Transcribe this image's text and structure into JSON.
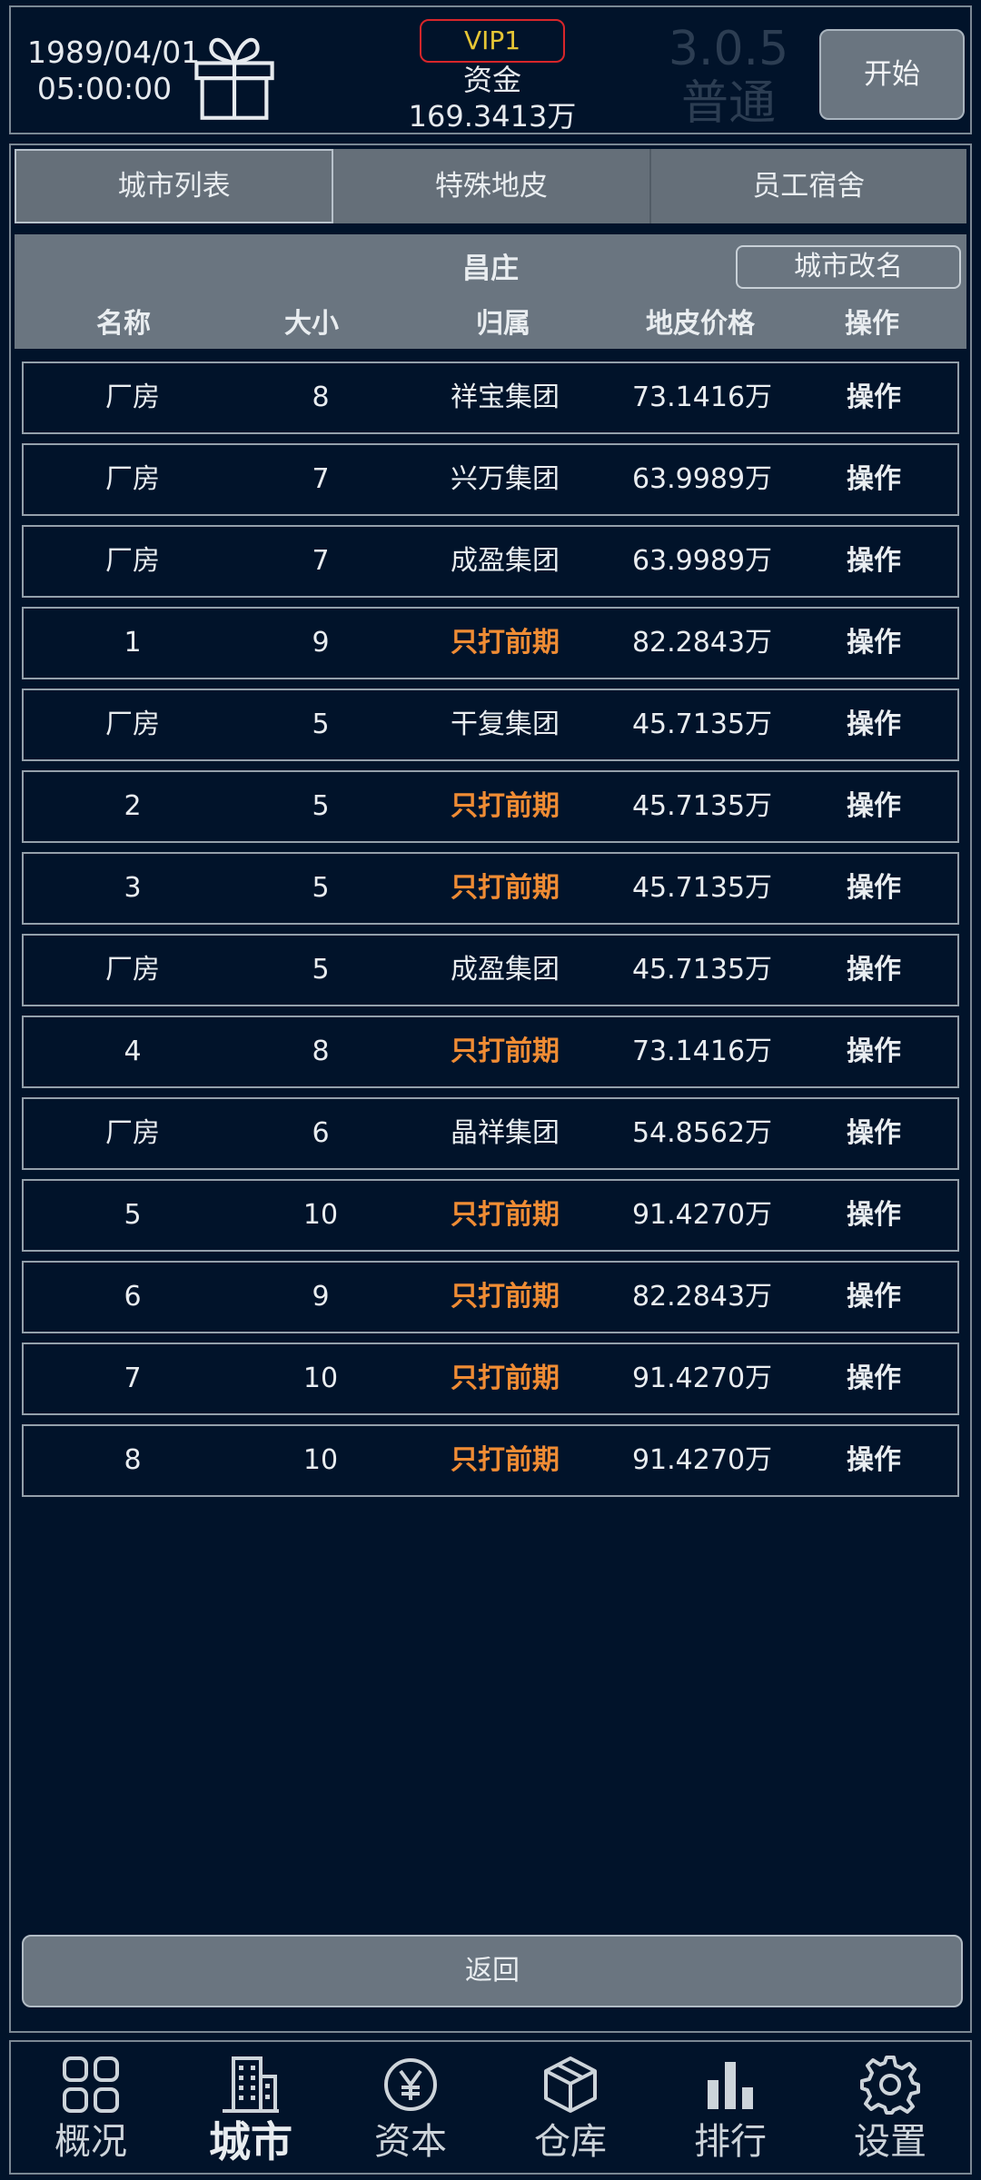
{
  "header": {
    "date": "1989/04/01",
    "time": "05:00:00",
    "vip": "VIP1",
    "funds_label": "资金",
    "funds_value": "169.3413万",
    "version": "3.0.5",
    "grade": "普通",
    "start_label": "开始"
  },
  "tabs": [
    {
      "label": "城市列表",
      "active": true
    },
    {
      "label": "特殊地皮",
      "active": false
    },
    {
      "label": "员工宿舍",
      "active": false
    }
  ],
  "city": {
    "name": "昌庄",
    "rename_label": "城市改名"
  },
  "columns": [
    "名称",
    "大小",
    "归属",
    "地皮价格",
    "操作"
  ],
  "rows": [
    {
      "name": "厂房",
      "size": "8",
      "owner": "祥宝集团",
      "price": "73.1416万",
      "op": "操作",
      "highlight": false
    },
    {
      "name": "厂房",
      "size": "7",
      "owner": "兴万集团",
      "price": "63.9989万",
      "op": "操作",
      "highlight": false
    },
    {
      "name": "厂房",
      "size": "7",
      "owner": "成盈集团",
      "price": "63.9989万",
      "op": "操作",
      "highlight": false
    },
    {
      "name": "1",
      "size": "9",
      "owner": "只打前期",
      "price": "82.2843万",
      "op": "操作",
      "highlight": true
    },
    {
      "name": "厂房",
      "size": "5",
      "owner": "干复集团",
      "price": "45.7135万",
      "op": "操作",
      "highlight": false
    },
    {
      "name": "2",
      "size": "5",
      "owner": "只打前期",
      "price": "45.7135万",
      "op": "操作",
      "highlight": true
    },
    {
      "name": "3",
      "size": "5",
      "owner": "只打前期",
      "price": "45.7135万",
      "op": "操作",
      "highlight": true
    },
    {
      "name": "厂房",
      "size": "5",
      "owner": "成盈集团",
      "price": "45.7135万",
      "op": "操作",
      "highlight": false
    },
    {
      "name": "4",
      "size": "8",
      "owner": "只打前期",
      "price": "73.1416万",
      "op": "操作",
      "highlight": true
    },
    {
      "name": "厂房",
      "size": "6",
      "owner": "晶祥集团",
      "price": "54.8562万",
      "op": "操作",
      "highlight": false
    },
    {
      "name": "5",
      "size": "10",
      "owner": "只打前期",
      "price": "91.4270万",
      "op": "操作",
      "highlight": true
    },
    {
      "name": "6",
      "size": "9",
      "owner": "只打前期",
      "price": "82.2843万",
      "op": "操作",
      "highlight": true
    },
    {
      "name": "7",
      "size": "10",
      "owner": "只打前期",
      "price": "91.4270万",
      "op": "操作",
      "highlight": true
    },
    {
      "name": "8",
      "size": "10",
      "owner": "只打前期",
      "price": "91.4270万",
      "op": "操作",
      "highlight": true
    }
  ],
  "back_label": "返回",
  "nav": [
    {
      "label": "概况",
      "icon": "grid-icon",
      "active": false
    },
    {
      "label": "城市",
      "icon": "building-icon",
      "active": true
    },
    {
      "label": "资本",
      "icon": "yen-icon",
      "active": false
    },
    {
      "label": "仓库",
      "icon": "box-icon",
      "active": false
    },
    {
      "label": "排行",
      "icon": "bar-chart-icon",
      "active": false
    },
    {
      "label": "设置",
      "icon": "gear-icon",
      "active": false
    }
  ],
  "colors": {
    "background": "#01132a",
    "panel": "#6a7580",
    "highlight": "#f08c34",
    "vip_border": "#d8262a",
    "vip_text": "#e6c635"
  }
}
